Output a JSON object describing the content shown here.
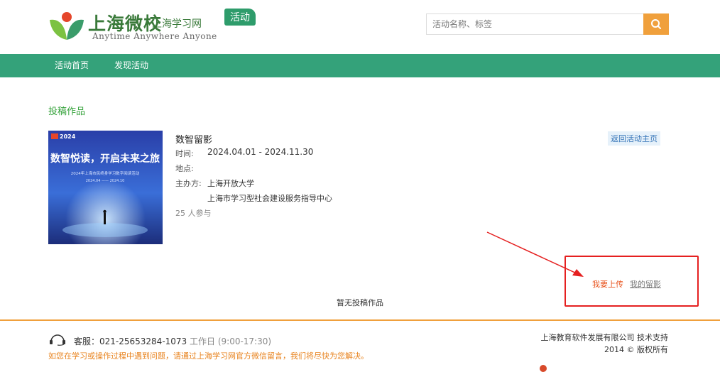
{
  "header": {
    "logo_title": "上海微校",
    "logo_subtitle": "上海学习网",
    "logo_slogan": "Anytime Anywhere Anyone",
    "logo_badge": "活动",
    "search_placeholder": "活动名称、标签",
    "search_value": "",
    "search_icon": "search-icon"
  },
  "nav": {
    "items": [
      {
        "label": "活动首页"
      },
      {
        "label": "发现活动"
      }
    ]
  },
  "main": {
    "section_title": "投稿作品",
    "activity": {
      "cover": {
        "year": "2024",
        "headline": "数智悦读，开启未来之旅",
        "subline": "2024年上海市民终身学习数字阅读活动",
        "dates": "2024.04 —— 2024.10"
      },
      "title": "数智留影",
      "time_label": "时间:",
      "time_value": "2024.04.01 - 2024.11.30",
      "place_label": "地点:",
      "place_value": "",
      "organizer_label": "主办方:",
      "organizers": [
        "上海开放大学",
        "上海市学习型社会建设服务指导中心"
      ],
      "participants": "25 人参与"
    },
    "back_link": "返回活动主页",
    "upload_link": "我要上传",
    "mine_link": "我的留影",
    "empty_message": "暂无投稿作品"
  },
  "footer": {
    "hotline_label": "客服：021-25653284-1073",
    "hotline_hours": "工作日 (9:00-17:30)",
    "help_text": "如您在学习或操作过程中遇到问题，请通过上海学习网官方微信留言，我们将尽快为您解决。",
    "company": "上海教育软件发展有限公司 技术支持",
    "copyright": "2014 © 版权所有"
  },
  "colors": {
    "brand_green": "#34a27a",
    "accent_orange": "#f0a03c",
    "annotation_red": "#e52020"
  }
}
